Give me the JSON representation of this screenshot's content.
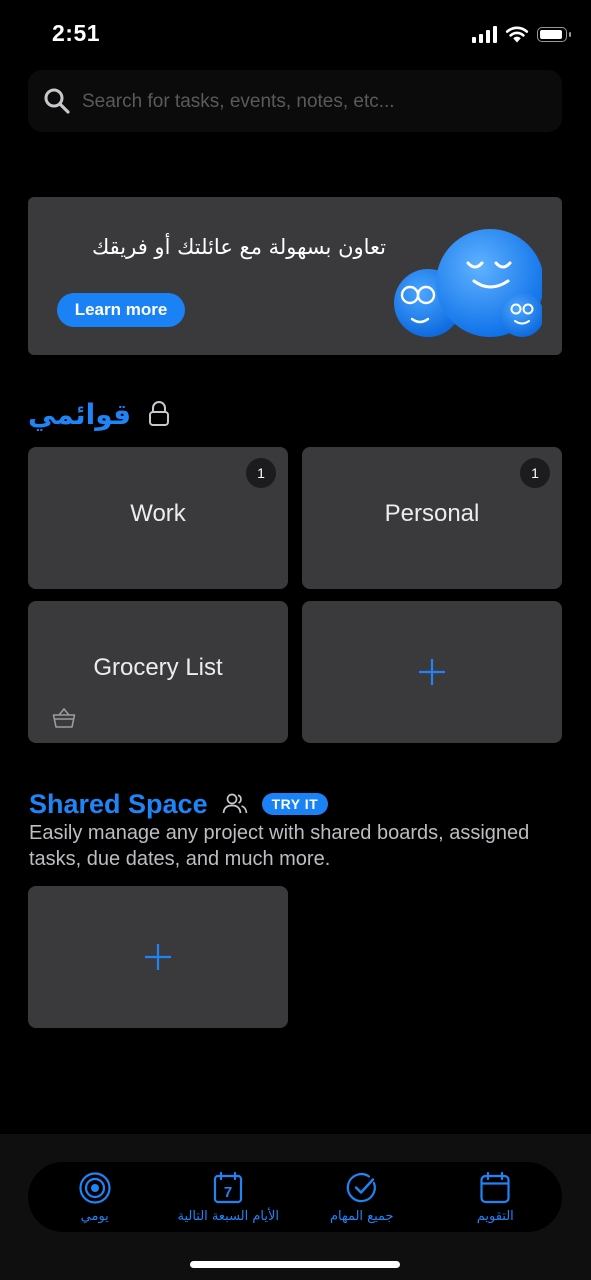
{
  "status_bar": {
    "time": "2:51"
  },
  "search": {
    "placeholder": "Search for tasks, events, notes, etc..."
  },
  "promo": {
    "text": "تعاون بسهولة مع عائلتك أو فريقك",
    "button_label": "Learn more"
  },
  "lists": {
    "title": "قوائمي",
    "tiles": [
      {
        "label": "Work",
        "badge": "1"
      },
      {
        "label": "Personal",
        "badge": "1"
      },
      {
        "label": "Grocery List",
        "icon": "basket-icon"
      },
      {
        "label": "",
        "icon": "plus-icon"
      }
    ]
  },
  "shared_space": {
    "title": "Shared Space",
    "badge": "TRY IT",
    "description": "Easily manage any project with shared boards, assigned tasks, due dates, and much more."
  },
  "tab_bar": {
    "items": [
      {
        "label": "يومي",
        "icon": "target-icon"
      },
      {
        "label": "الأيام السبعة التالية",
        "icon": "calendar-7-icon",
        "icon_text": "7"
      },
      {
        "label": "جميع المهام",
        "icon": "check-circle-icon"
      },
      {
        "label": "التقويم",
        "icon": "calendar-icon"
      }
    ]
  },
  "colors": {
    "accent": "#1f84f6",
    "tile": "#3a3a3c",
    "background": "#000000"
  }
}
